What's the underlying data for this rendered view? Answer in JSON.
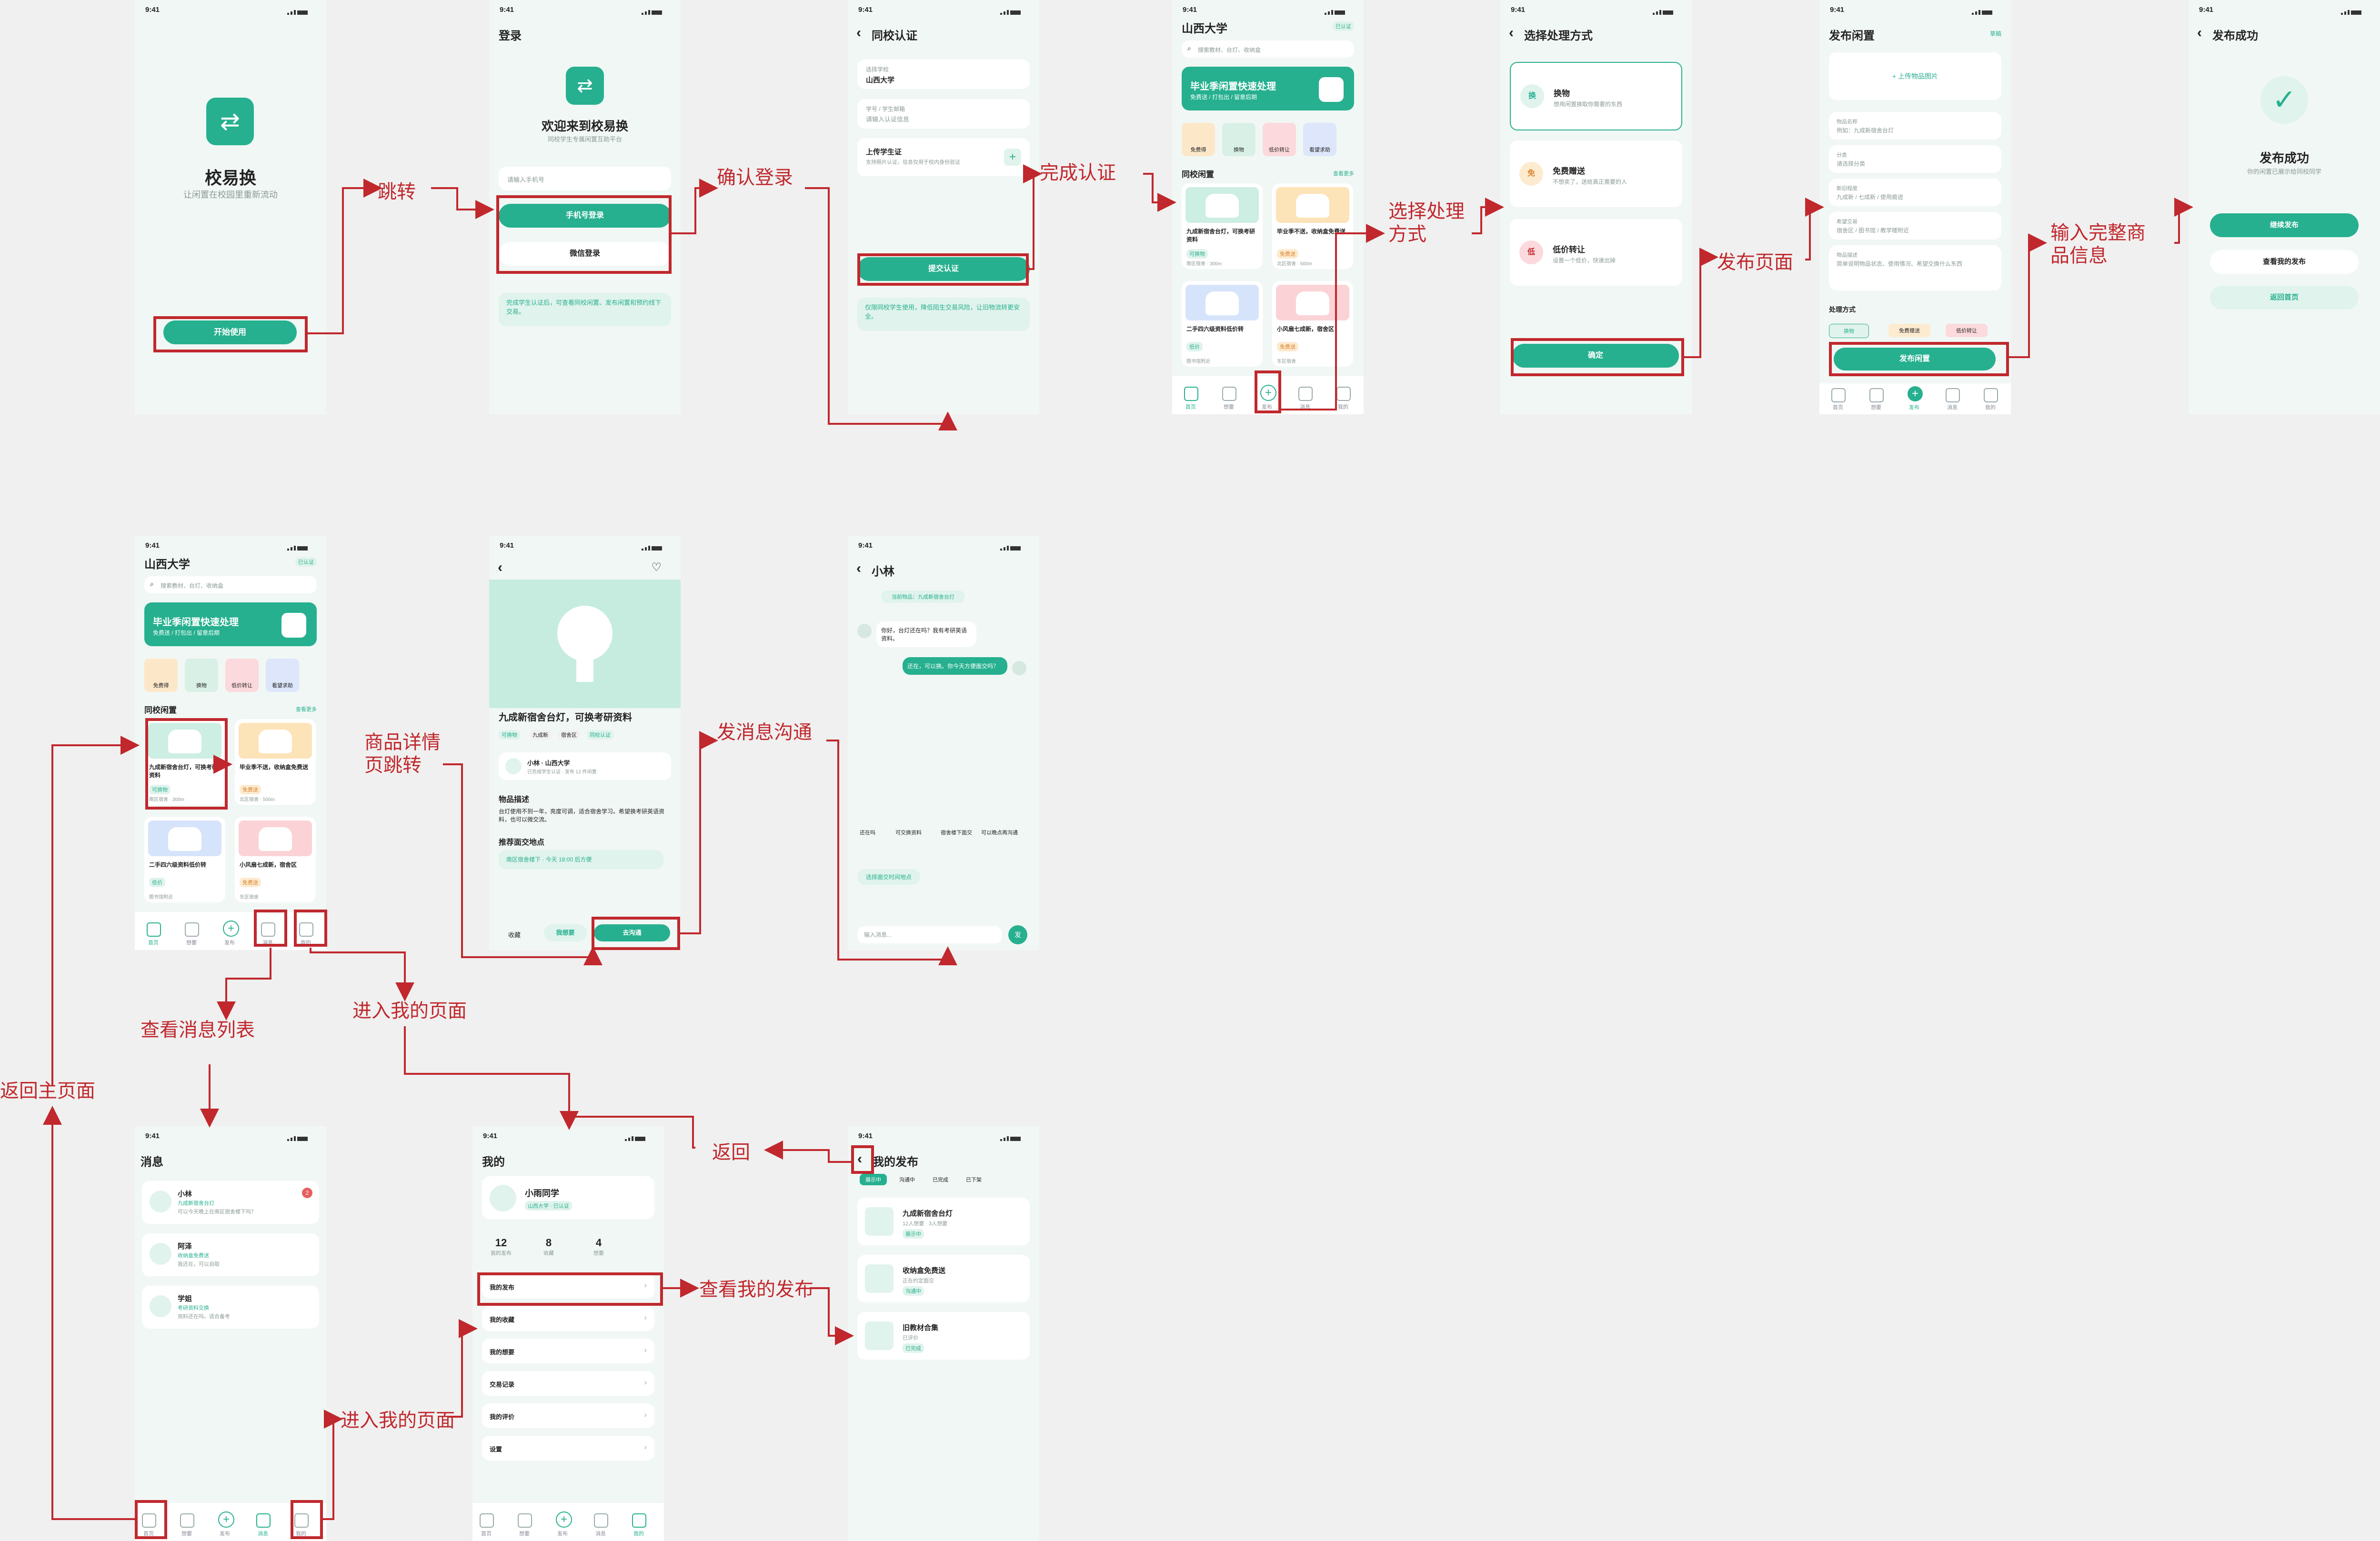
{
  "status_time": "9:41",
  "nav": {
    "home": "首页",
    "want": "想要",
    "publish": "发布",
    "msg": "消息",
    "mine": "我的"
  },
  "annotations": {
    "jump": "跳转",
    "confirm_login": "确认登录",
    "finish_auth": "完成认证",
    "choose_way": "选择处理方式",
    "publish_page": "发布页面",
    "input_info": "输入完整商品信息",
    "detail_jump": "商品详情页跳转",
    "send_msg": "发消息沟通",
    "msg_list": "查看消息列表",
    "enter_mine1": "进入我的页面",
    "back_home": "返回主页面",
    "back": "返回",
    "my_posts": "查看我的发布",
    "enter_mine2": "进入我的页面"
  },
  "splash": {
    "title": "校易换",
    "subtitle": "让闲置在校园里重新流动",
    "start": "开始使用"
  },
  "login": {
    "header": "登录",
    "welcome": "欢迎来到校易换",
    "desc": "同校学生专属闲置互助平台",
    "phone_ph": "请输入手机号",
    "phone_btn": "手机号登录",
    "wechat_btn": "微信登录",
    "tip": "完成学生认证后，可查看同校闲置、发布闲置和预约线下交易。"
  },
  "auth": {
    "header": "同校认证",
    "school_label": "选择学校",
    "school": "山西大学",
    "id_label": "学号 / 学生邮箱",
    "id_ph": "请输入认证信息",
    "upload_label": "上传学生证",
    "upload_desc": "支持照片认证，信息仅用于校内身份验证",
    "submit": "提交认证",
    "tip": "仅限同校学生使用，降低陌生交易风险，让旧物流转更安全。"
  },
  "home": {
    "school": "山西大学",
    "verified": "已认证",
    "search_ph": "搜索教材、台灯、收纳盒",
    "banner_title": "毕业季闲置快速处理",
    "banner_sub": "免费送 / 打包出 / 留意后期",
    "cats": [
      "免费得",
      "换物",
      "低价转让",
      "看望求助"
    ],
    "section": "同校闲置",
    "more": "查看更多",
    "items": [
      {
        "title": "九成新宿舍台灯，可换考研资料",
        "tag": "可换物",
        "meta": "南区宿舍 · 300m"
      },
      {
        "title": "毕业季不送，收纳盒免费送",
        "tag": "免费送",
        "meta": "北区宿舍 · 500m"
      },
      {
        "title": "二手四六级资料低价转",
        "tag": "低价",
        "meta": "图书馆附近"
      },
      {
        "title": "小风扇七成新，宿舍区",
        "tag": "免费送",
        "meta": "东区宿舍"
      }
    ]
  },
  "method": {
    "header": "选择处理方式",
    "opts": [
      {
        "icon": "换",
        "title": "换物",
        "desc": "想用闲置换取你需要的东西"
      },
      {
        "icon": "免",
        "title": "免费赠送",
        "desc": "不想卖了，送给真正需要的人"
      },
      {
        "icon": "低",
        "title": "低价转让",
        "desc": "设置一个低价，快速出掉"
      }
    ],
    "confirm": "确定"
  },
  "publish": {
    "header": "发布闲置",
    "draft": "草稿",
    "upload": "+ 上传物品图片",
    "fields": [
      {
        "label": "物品名称",
        "ph": "例如：九成新宿舍台灯"
      },
      {
        "label": "分类",
        "ph": "请选择分类"
      },
      {
        "label": "新旧程度",
        "ph": "九成新 / 七成新 / 使用痕迹"
      },
      {
        "label": "希望交易",
        "ph": "宿舍区 / 图书馆 / 教学楼附近"
      },
      {
        "label": "物品描述",
        "ph": "简单说明物品状态、使用情况、希望交换什么东西"
      }
    ],
    "way_label": "处理方式",
    "ways": [
      "换物",
      "免费赠送",
      "低价转让"
    ],
    "submit": "发布闲置"
  },
  "success": {
    "header": "发布成功",
    "title": "发布成功",
    "desc": "你的闲置已展示给同校同学",
    "continue": "继续发布",
    "view": "查看我的发布",
    "home": "返回首页"
  },
  "detail": {
    "title": "九成新宿舍台灯，可换考研资料",
    "tags": [
      "可换物",
      "九成新",
      "宿舍区",
      "同校认证"
    ],
    "seller": "小林 · 山西大学",
    "seller_sub": "已完成学生认证 · 发布 12 件闲置",
    "desc_h": "物品描述",
    "desc": "台灯使用不到一年，亮度可调，适合宿舍学习。希望换考研英语资料，也可以微交流。",
    "place_h": "推荐面交地点",
    "place": "南区宿舍楼下 · 今天 18:00 后方便",
    "collect": "收藏",
    "want": "我想要",
    "chat": "去沟通"
  },
  "chat": {
    "header": "小林",
    "item": "当前物品：九成新宿舍台灯",
    "m1": "你好，台灯还在吗？我有考研英语资料。",
    "m2": "还在，可以换。你今天方便面交吗？",
    "quick": [
      "还在吗",
      "可交换资料",
      "宿舍楼下面交",
      "可以晚点再沟通"
    ],
    "action": "选择面交时间地点",
    "input_ph": "输入消息...",
    "send": "发"
  },
  "messages": {
    "header": "消息",
    "list": [
      {
        "name": "小林",
        "sub": "九成新宿舍台灯",
        "msg": "可以今天晚上在南区宿舍楼下吗？",
        "badge": "2"
      },
      {
        "name": "阿泽",
        "sub": "收纳盒免费送",
        "msg": "我还在，可以自取"
      },
      {
        "name": "学姐",
        "sub": "考研资料交换",
        "msg": "资料还在吗，适合备考"
      }
    ]
  },
  "mine": {
    "header": "我的",
    "name": "小雨同学",
    "sub": "山西大学 · 已认证",
    "stats": [
      {
        "n": "12",
        "l": "我的发布"
      },
      {
        "n": "8",
        "l": "收藏"
      },
      {
        "n": "4",
        "l": "想要"
      }
    ],
    "menu": [
      "我的发布",
      "我的收藏",
      "我的想要",
      "交易记录",
      "我的评价",
      "设置"
    ]
  },
  "myposts": {
    "header": "我的发布",
    "tabs": [
      "展示中",
      "沟通中",
      "已完成",
      "已下架"
    ],
    "items": [
      {
        "title": "九成新宿舍台灯",
        "sub": "12人想要 · 3人想要",
        "tag": "展示中"
      },
      {
        "title": "收纳盒免费送",
        "sub": "正在约定面交",
        "tag": "沟通中"
      },
      {
        "title": "旧教材合集",
        "sub": "已评价",
        "tag": "已完成"
      }
    ]
  },
  "colors": {
    "accent": "#26b08f",
    "annotation": "#c0282d",
    "bg": "#f0f0f0"
  }
}
